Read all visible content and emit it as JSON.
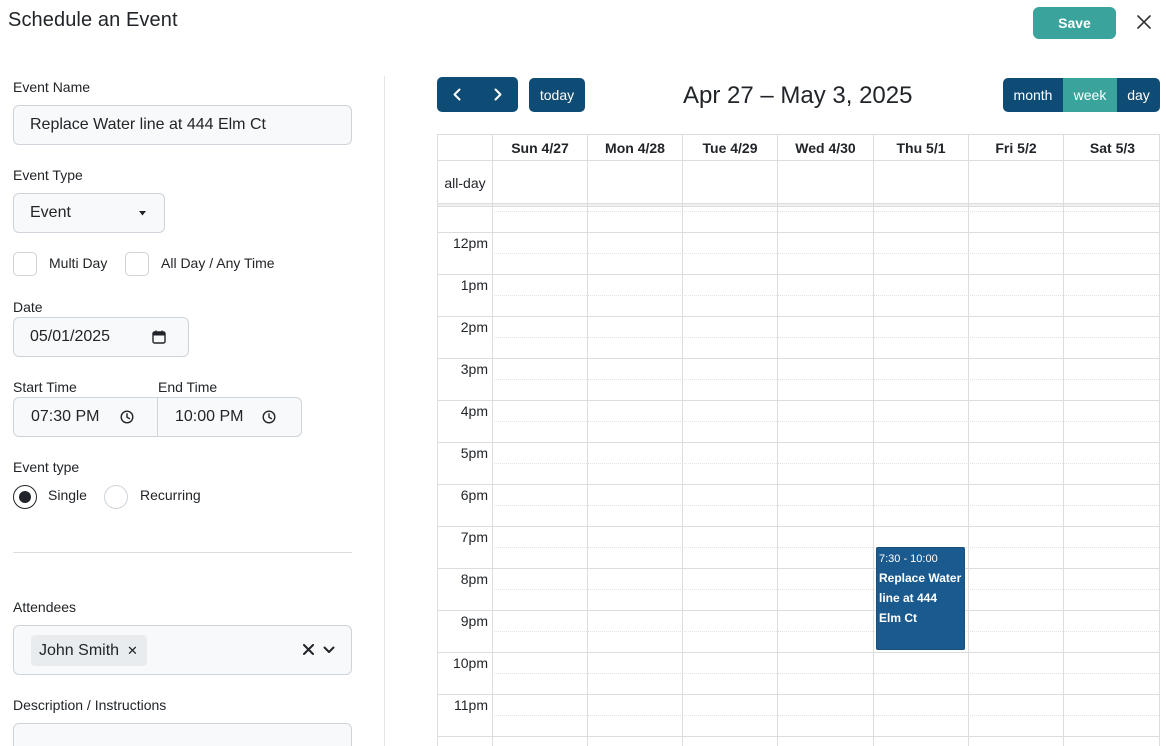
{
  "header": {
    "title": "Schedule an Event",
    "save_label": "Save",
    "close_icon": "close-icon"
  },
  "form": {
    "event_name_label": "Event Name",
    "event_name_value": "Replace Water line at 444 Elm Ct",
    "event_type_label": "Event Type",
    "event_type_value": "Event",
    "multi_day_label": "Multi Day",
    "all_day_label": "All Day / Any Time",
    "date_label": "Date",
    "date_value": "05/01/2025",
    "start_time_label": "Start Time",
    "start_time_value": "07:30 PM",
    "end_time_label": "End Time",
    "end_time_value": "10:00 PM",
    "recurrence_label": "Event type",
    "single_label": "Single",
    "recurring_label": "Recurring",
    "selected_recurrence": "Single",
    "attendees_label": "Attendees",
    "attendees": [
      "John Smith"
    ],
    "description_label": "Description / Instructions"
  },
  "calendar": {
    "range_title": "Apr 27 – May 3, 2025",
    "today_label": "today",
    "views": [
      "month",
      "week",
      "day"
    ],
    "active_view": "week",
    "days": [
      "Sun 4/27",
      "Mon 4/28",
      "Tue 4/29",
      "Wed 4/30",
      "Thu 5/1",
      "Fri 5/2",
      "Sat 5/3"
    ],
    "all_day_label": "all-day",
    "hours": [
      "12pm",
      "1pm",
      "2pm",
      "3pm",
      "4pm",
      "5pm",
      "6pm",
      "7pm",
      "8pm",
      "9pm",
      "10pm",
      "11pm"
    ],
    "event": {
      "day": "Thu 5/1",
      "time": "7:30 - 10:00",
      "title": "Replace Water line at 444 Elm Ct"
    }
  },
  "colors": {
    "primary": "#0f4c75",
    "accent": "#3aa39b",
    "event": "#1b5a8e"
  }
}
